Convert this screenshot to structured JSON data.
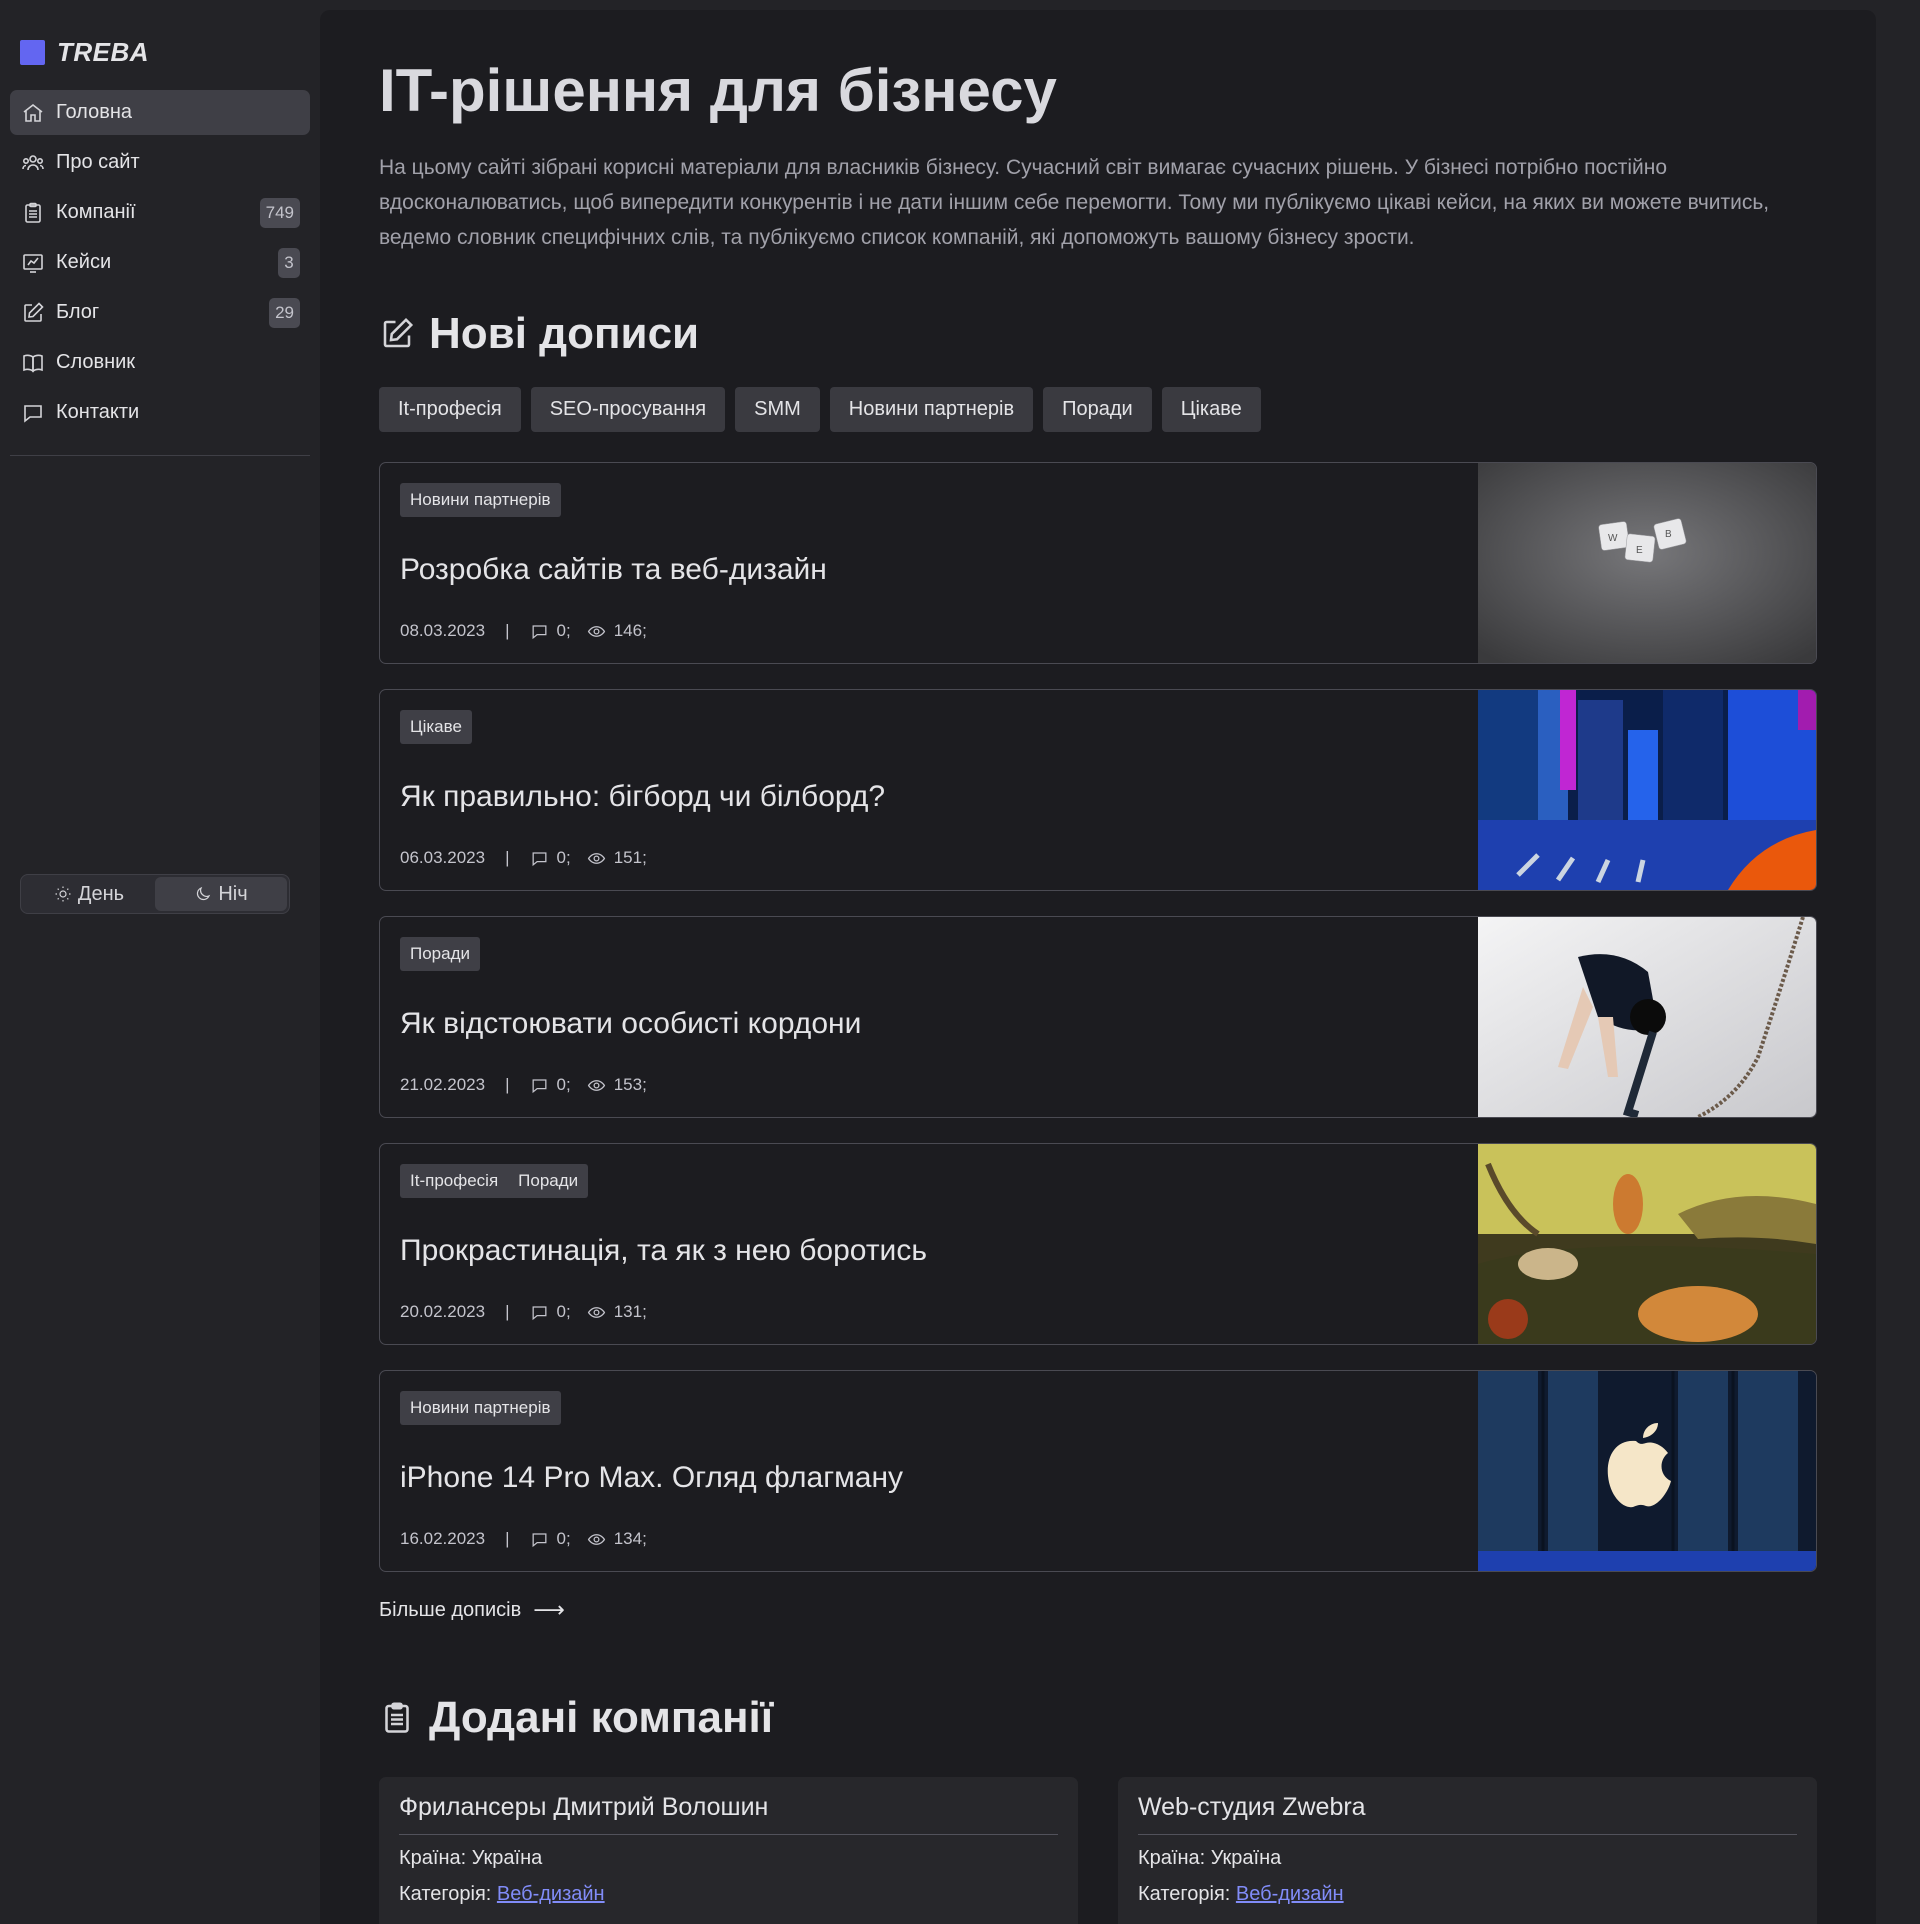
{
  "brand": {
    "name": "TREBA",
    "accent": "#6366f1"
  },
  "sidebar": {
    "items": [
      {
        "label": "Головна",
        "icon": "home-icon",
        "badge": null
      },
      {
        "label": "Про сайт",
        "icon": "users-icon",
        "badge": null
      },
      {
        "label": "Компанії",
        "icon": "clipboard-icon",
        "badge": "749"
      },
      {
        "label": "Кейси",
        "icon": "chart-icon",
        "badge": "3"
      },
      {
        "label": "Блог",
        "icon": "edit-icon",
        "badge": "29"
      },
      {
        "label": "Словник",
        "icon": "book-icon",
        "badge": null
      },
      {
        "label": "Контакти",
        "icon": "chat-icon",
        "badge": null
      }
    ],
    "theme": {
      "day": "День",
      "night": "Ніч"
    }
  },
  "main": {
    "title": "IT-рішення для бізнесу",
    "intro": "На цьому сайті зібрані корисні матеріали для власників бізнесу. Сучасний світ вимагає сучасних рішень. У бізнесі потрібно постійно вдосконалюватись, щоб випередити конкурентів і не дати іншим себе перемогти. Тому ми публікуємо цікаві кейси, на яких ви можете вчитись, ведемо словник специфічних слів, та публікуємо список компаній, які допоможуть вашому бізнесу зрости.",
    "posts_section": {
      "title": "Нові дописи",
      "tags": [
        "It-професія",
        "SEO-просування",
        "SMM",
        "Новини партнерів",
        "Поради",
        "Цікаве"
      ],
      "posts": [
        {
          "tags": [
            "Новини партнерів"
          ],
          "title": "Розробка сайтів та веб-дизайн",
          "date": "08.03.2023",
          "sep": "|",
          "comments": "0;",
          "views": "146;"
        },
        {
          "tags": [
            "Цікаве"
          ],
          "title": "Як правильно: бігборд чи білборд?",
          "date": "06.03.2023",
          "sep": "|",
          "comments": "0;",
          "views": "151;"
        },
        {
          "tags": [
            "Поради"
          ],
          "title": "Як відстоювати особисті кордони",
          "date": "21.02.2023",
          "sep": "|",
          "comments": "0;",
          "views": "153;"
        },
        {
          "tags": [
            "It-професія",
            "Поради"
          ],
          "title": "Прокрастинація, та як з нею боротись",
          "date": "20.02.2023",
          "sep": "|",
          "comments": "0;",
          "views": "131;"
        },
        {
          "tags": [
            "Новини партнерів"
          ],
          "title": "iPhone 14 Pro Max. Огляд флагману",
          "date": "16.02.2023",
          "sep": "|",
          "comments": "0;",
          "views": "134;"
        }
      ],
      "more": "Більше дописів",
      "more_arrow": "⟶"
    },
    "companies_section": {
      "title": "Додані компанії",
      "companies": [
        {
          "name": "Фрилансеры Дмитрий Волошин",
          "country_label": "Країна:",
          "country": "Україна",
          "category_label": "Категорія:",
          "category": "Веб-дизайн"
        },
        {
          "name": "Web-студия Zwebra",
          "country_label": "Країна:",
          "country": "Україна",
          "category_label": "Категорія:",
          "category": "Веб-дизайн"
        }
      ]
    }
  }
}
